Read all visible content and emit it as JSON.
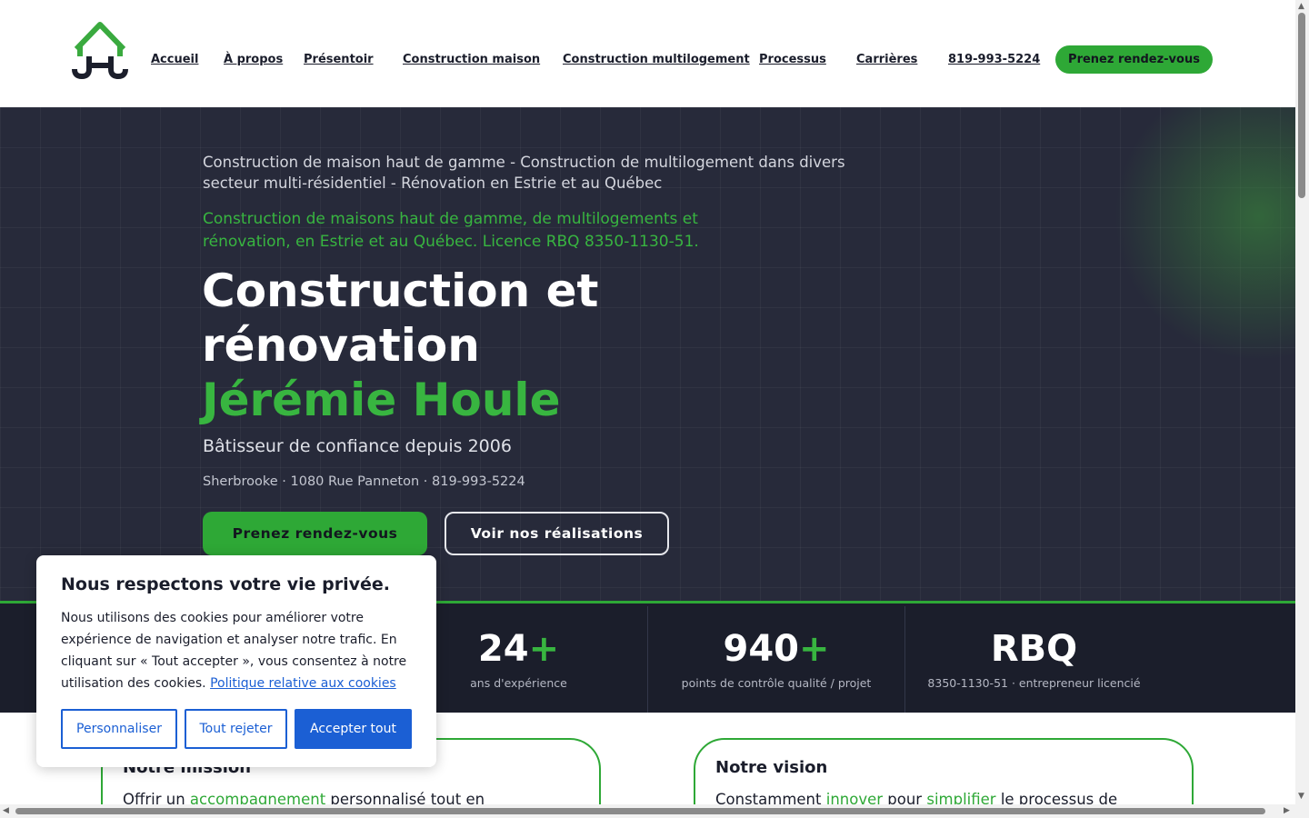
{
  "header": {
    "logo_text": "JHC",
    "nav": [
      "Accueil",
      "À propos",
      "Présentoir",
      "Construction maison",
      "Construction multilogement",
      "Processus",
      "Carrières",
      "819-993-5224"
    ],
    "cta": "Prenez rendez-vous"
  },
  "hero": {
    "tagline": "Construction de maison haut de gamme - Construction de multilogement dans divers secteur multi-résidentiel - Rénovation en Estrie et au Québec",
    "licence": "Construction de maisons haut de gamme, de multilogements et rénovation, en Estrie et au Québec. Licence RBQ 8350-1130-51.",
    "title_line1": "Construction et",
    "title_line2": "rénovation",
    "title_line3": "Jérémie Houle",
    "subtitle": "Bâtisseur de confiance depuis 2006",
    "info": "Sherbrooke · 1080 Rue Panneton · 819-993-5224",
    "btn_primary": "Prenez rendez-vous",
    "btn_secondary": "Voir nos réalisations"
  },
  "stats": [
    {
      "value": "24",
      "suffix": "+",
      "label": "ans d'expérience"
    },
    {
      "value": "940",
      "suffix": "+",
      "label": "points de contrôle qualité / projet"
    },
    {
      "value": "RBQ",
      "suffix": "",
      "label": "8350-1130-51 · entrepreneur licencié"
    }
  ],
  "cards": {
    "mission": {
      "title": "Notre mission",
      "text_a": "Offrir un ",
      "text_hl": "accompagnement",
      "text_b": " personnalisé tout en"
    },
    "vision": {
      "title": "Notre vision",
      "text_a": "Constamment ",
      "text_hl1": "innover",
      "text_b": " pour ",
      "text_hl2": "simplifier",
      "text_c": " le processus de"
    }
  },
  "cookie": {
    "title": "Nous respectons votre vie privée.",
    "text": "Nous utilisons des cookies pour améliorer votre expérience de navigation et analyser notre trafic. En cliquant sur « Tout accepter », vous consentez à notre utilisation des cookies.",
    "link": "Politique relative aux cookies",
    "btn_customize": "Personnaliser",
    "btn_reject": "Tout rejeter",
    "btn_accept": "Accepter tout"
  },
  "colors": {
    "brand_green": "#2ea836",
    "hero_bg": "#272a3a",
    "stats_bg": "#1b1e2b",
    "cookie_blue": "#1b5fd4"
  }
}
